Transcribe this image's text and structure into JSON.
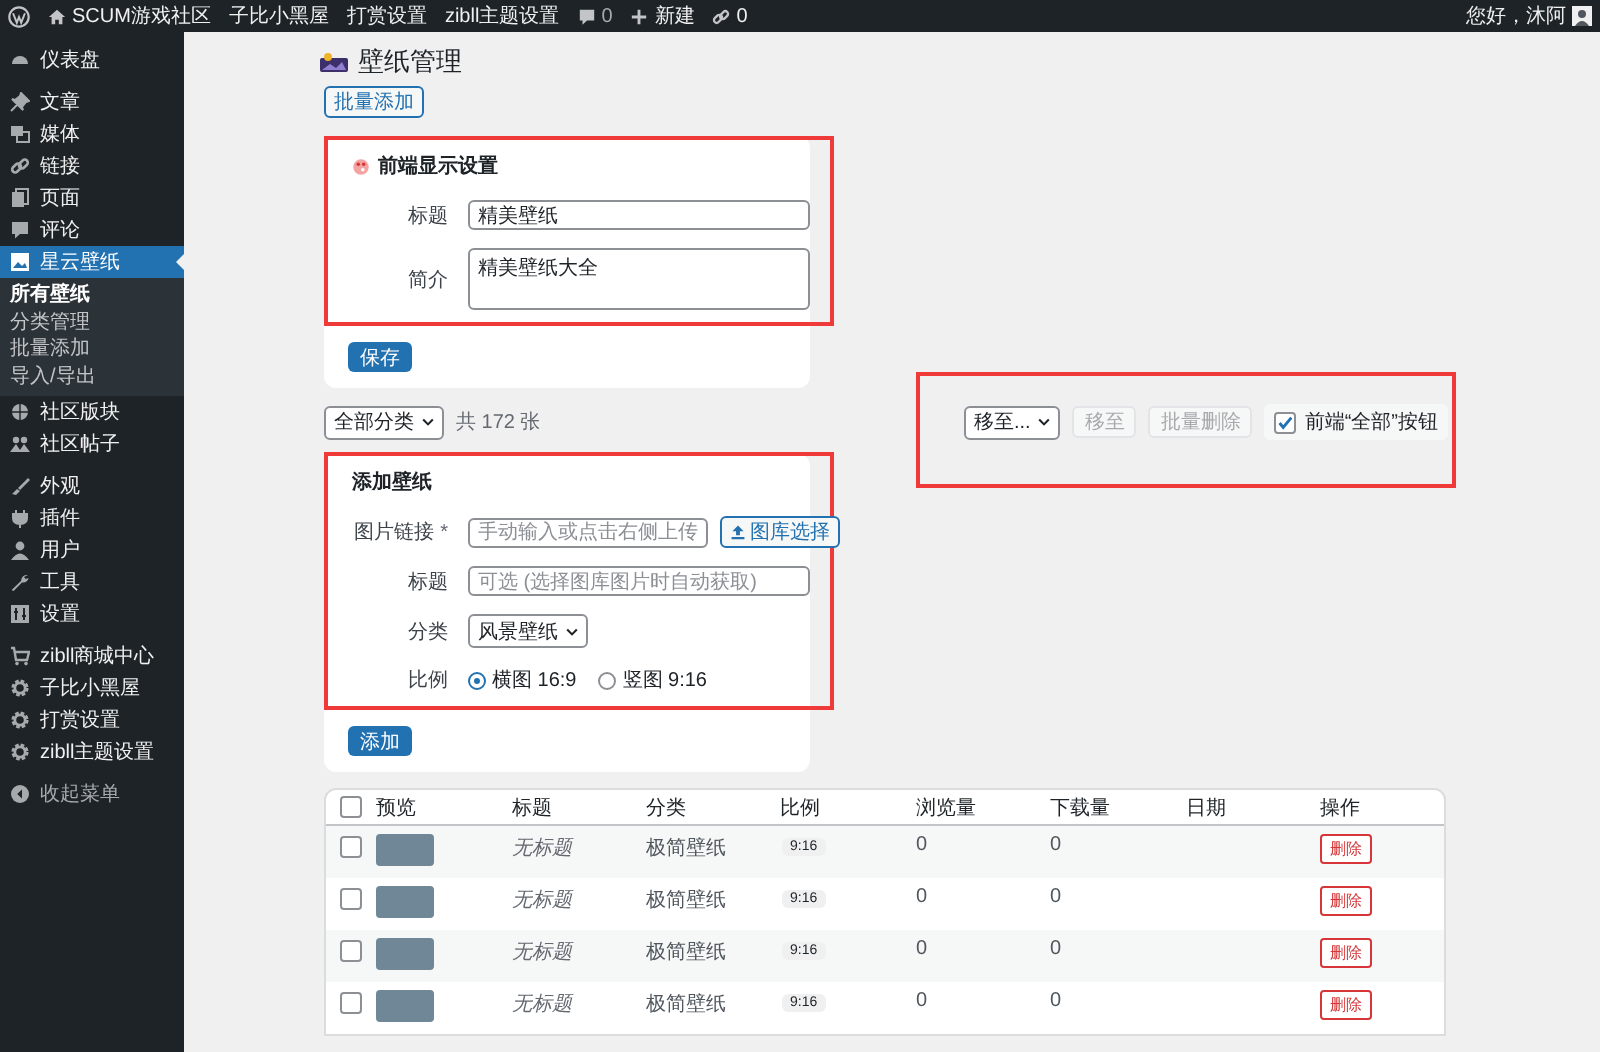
{
  "admin_bar": {
    "site": "SCUM游戏社区",
    "links": [
      "子比小黑屋",
      "打赏设置",
      "zibll主题设置"
    ],
    "comments": "0",
    "new": "新建",
    "link_count": "0",
    "greeting": "您好，沐阿"
  },
  "sidebar": {
    "groups": [
      [
        {
          "label": "仪表盘",
          "selected": false
        }
      ],
      [
        {
          "label": "文章",
          "selected": false
        },
        {
          "label": "媒体",
          "selected": false
        },
        {
          "label": "链接",
          "selected": false
        },
        {
          "label": "页面",
          "selected": false
        },
        {
          "label": "评论",
          "selected": false
        },
        {
          "label": "星云壁纸",
          "selected": true,
          "submenu": [
            {
              "label": "所有壁纸",
              "selected": true
            },
            {
              "label": "分类管理",
              "selected": false
            },
            {
              "label": "批量添加",
              "selected": false
            },
            {
              "label": "导入/导出",
              "selected": false
            }
          ]
        },
        {
          "label": "社区版块",
          "selected": false
        },
        {
          "label": "社区帖子",
          "selected": false
        }
      ],
      [
        {
          "label": "外观",
          "selected": false
        },
        {
          "label": "插件",
          "selected": false
        },
        {
          "label": "用户",
          "selected": false
        },
        {
          "label": "工具",
          "selected": false
        },
        {
          "label": "设置",
          "selected": false
        }
      ],
      [
        {
          "label": "zibll商城中心",
          "selected": false
        },
        {
          "label": "子比小黑屋",
          "selected": false
        },
        {
          "label": "打赏设置",
          "selected": false
        },
        {
          "label": "zibll主题设置",
          "selected": false
        }
      ]
    ],
    "collapse": "收起菜单"
  },
  "page": {
    "title": "壁纸管理",
    "bulk_add_button": "批量添加"
  },
  "display_settings": {
    "heading": "前端显示设置",
    "fields": [
      {
        "label": "标题",
        "kind": "text",
        "value": "精美壁纸"
      },
      {
        "label": "简介",
        "kind": "textarea",
        "value": "精美壁纸大全"
      }
    ],
    "save_button": "保存"
  },
  "toolbar": {
    "category_filter": "全部分类",
    "count": "共 172 张",
    "move_select": "移至...",
    "move_button": {
      "label": "移至",
      "disabled": true
    },
    "delete_button": {
      "label": "批量删除",
      "disabled": true
    },
    "toggle": {
      "label": "前端“全部”按钮",
      "checked": true
    }
  },
  "add_wallpaper": {
    "heading": "添加壁纸",
    "fields": [
      {
        "label": "图片链接",
        "required_mark": "*",
        "kind": "text",
        "placeholder": "手动输入或点击右侧上传",
        "button": "图库选择"
      },
      {
        "label": "标题",
        "kind": "text",
        "placeholder": "可选 (选择图库图片时自动获取)"
      },
      {
        "label": "分类",
        "kind": "select",
        "value": "风景壁纸"
      },
      {
        "label": "比例",
        "kind": "radio",
        "options": [
          {
            "label": "横图 16:9",
            "selected": true
          },
          {
            "label": "竖图 9:16",
            "selected": false
          }
        ]
      }
    ],
    "add_button": "添加"
  },
  "table": {
    "select_all_checked": false,
    "columns": [
      "预览",
      "标题",
      "分类",
      "比例",
      "浏览量",
      "下载量",
      "日期",
      "操作"
    ],
    "rows": [
      {
        "checked": false,
        "title": "无标题",
        "category": "极简壁纸",
        "ratio": "9:16",
        "views": "0",
        "downloads": "0",
        "action": "删除"
      },
      {
        "checked": false,
        "title": "无标题",
        "category": "极简壁纸",
        "ratio": "9:16",
        "views": "0",
        "downloads": "0",
        "action": "删除"
      },
      {
        "checked": false,
        "title": "无标题",
        "category": "极简壁纸",
        "ratio": "9:16",
        "views": "0",
        "downloads": "0",
        "action": "删除"
      },
      {
        "checked": false,
        "title": "无标题",
        "category": "极简壁纸",
        "ratio": "9:16",
        "views": "0",
        "downloads": "0",
        "action": "删除"
      }
    ]
  }
}
